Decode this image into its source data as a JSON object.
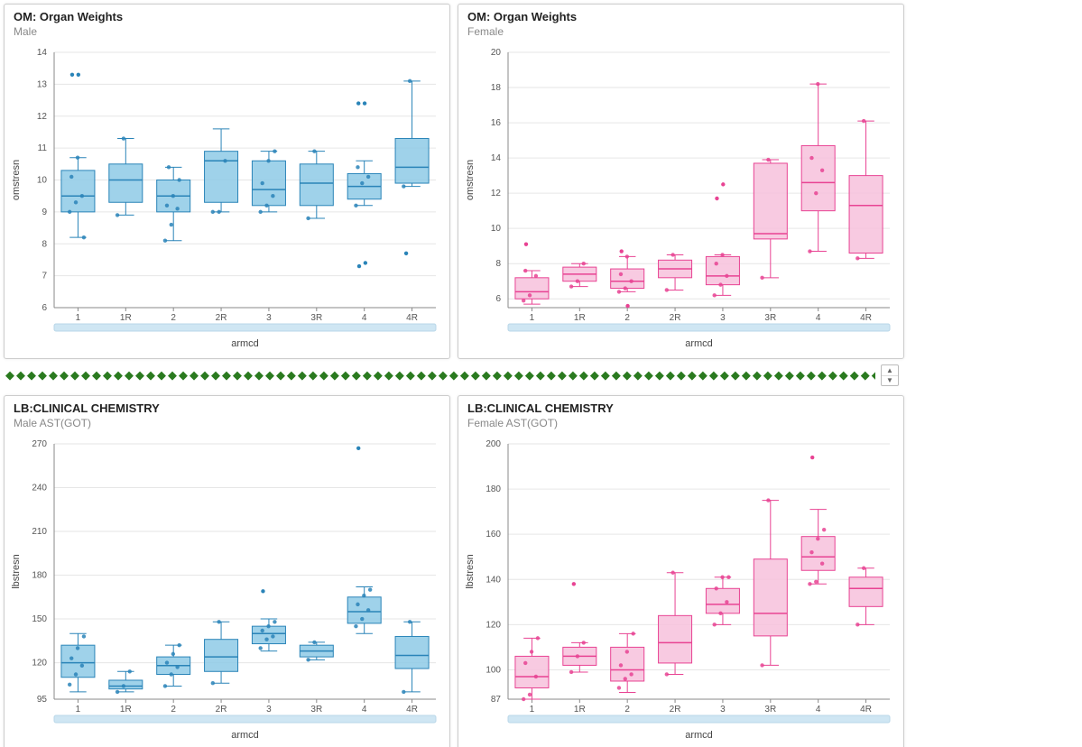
{
  "palette": {
    "male_fill": "#8ecae6",
    "male_stroke": "#2a84b8",
    "female_fill": "#f7c1dc",
    "female_stroke": "#e84393",
    "grid": "#e6e6e6",
    "text": "#444444"
  },
  "panels": {
    "om_male": {
      "title": "OM: Organ Weights",
      "subtitle": "Male",
      "xlabel": "armcd",
      "ylabel": "omstresn"
    },
    "om_female": {
      "title": "OM: Organ Weights",
      "subtitle": "Female",
      "xlabel": "armcd",
      "ylabel": "omstresn"
    },
    "lb_male": {
      "title": "LB:CLINICAL CHEMISTRY",
      "subtitle": "Male AST(GOT)",
      "xlabel": "armcd",
      "ylabel": "lbstresn"
    },
    "lb_female": {
      "title": "LB:CLINICAL CHEMISTRY",
      "subtitle": "Female AST(GOT)",
      "xlabel": "armcd",
      "ylabel": "lbstresn"
    }
  },
  "chart_data": [
    {
      "id": "om_male",
      "type": "box",
      "color": "male",
      "categories": [
        "1",
        "1R",
        "2",
        "2R",
        "3",
        "3R",
        "4",
        "4R"
      ],
      "ylim": [
        6,
        14
      ],
      "yticks": [
        6,
        7,
        8,
        9,
        10,
        11,
        12,
        13,
        14
      ],
      "series": [
        {
          "cat": "1",
          "min": 8.2,
          "q1": 9.0,
          "med": 9.5,
          "q3": 10.3,
          "max": 10.7,
          "pts": [
            9.0,
            9.3,
            9.5,
            10.1,
            10.7,
            8.2
          ],
          "outliers": [
            13.3,
            13.3
          ]
        },
        {
          "cat": "1R",
          "min": 8.9,
          "q1": 9.3,
          "med": 10.0,
          "q3": 10.5,
          "max": 11.3,
          "pts": [
            8.9,
            11.3
          ],
          "outliers": []
        },
        {
          "cat": "2",
          "min": 8.1,
          "q1": 9.0,
          "med": 9.5,
          "q3": 10.0,
          "max": 10.4,
          "pts": [
            8.1,
            8.6,
            9.1,
            9.2,
            9.5,
            10.0,
            10.4
          ],
          "outliers": []
        },
        {
          "cat": "2R",
          "min": 9.0,
          "q1": 9.3,
          "med": 10.6,
          "q3": 10.9,
          "max": 11.6,
          "pts": [
            9.0,
            9.0,
            10.6
          ],
          "outliers": []
        },
        {
          "cat": "3",
          "min": 9.0,
          "q1": 9.2,
          "med": 9.7,
          "q3": 10.6,
          "max": 10.9,
          "pts": [
            9.0,
            9.2,
            9.5,
            9.9,
            10.6,
            10.9
          ],
          "outliers": []
        },
        {
          "cat": "3R",
          "min": 8.8,
          "q1": 9.2,
          "med": 9.9,
          "q3": 10.5,
          "max": 10.9,
          "pts": [
            8.8,
            10.9
          ],
          "outliers": []
        },
        {
          "cat": "4",
          "min": 9.2,
          "q1": 9.4,
          "med": 9.8,
          "q3": 10.2,
          "max": 10.6,
          "pts": [
            9.2,
            9.9,
            10.1,
            10.4
          ],
          "outliers": [
            12.4,
            12.4,
            7.3,
            7.4
          ]
        },
        {
          "cat": "4R",
          "min": 9.8,
          "q1": 9.9,
          "med": 10.4,
          "q3": 11.3,
          "max": 13.1,
          "pts": [
            9.8,
            13.1
          ],
          "outliers": [
            7.7
          ]
        }
      ]
    },
    {
      "id": "om_female",
      "type": "box",
      "color": "female",
      "categories": [
        "1",
        "1R",
        "2",
        "2R",
        "3",
        "3R",
        "4",
        "4R"
      ],
      "ylim": [
        5.5,
        20
      ],
      "yticks": [
        6,
        8,
        10,
        12,
        14,
        16,
        18,
        20
      ],
      "series": [
        {
          "cat": "1",
          "min": 5.7,
          "q1": 6.0,
          "med": 6.4,
          "q3": 7.2,
          "max": 7.6,
          "pts": [
            5.9,
            6.2,
            7.3,
            7.6
          ],
          "outliers": [
            9.1
          ]
        },
        {
          "cat": "1R",
          "min": 6.7,
          "q1": 7.0,
          "med": 7.4,
          "q3": 7.8,
          "max": 8.0,
          "pts": [
            6.7,
            7.0,
            8.0
          ],
          "outliers": []
        },
        {
          "cat": "2",
          "min": 6.4,
          "q1": 6.6,
          "med": 7.0,
          "q3": 7.7,
          "max": 8.4,
          "pts": [
            6.4,
            6.6,
            7.0,
            7.4,
            8.4
          ],
          "outliers": [
            8.7,
            5.6
          ]
        },
        {
          "cat": "2R",
          "min": 6.5,
          "q1": 7.2,
          "med": 7.7,
          "q3": 8.2,
          "max": 8.5,
          "pts": [
            6.5,
            8.5
          ],
          "outliers": []
        },
        {
          "cat": "3",
          "min": 6.2,
          "q1": 6.8,
          "med": 7.3,
          "q3": 8.4,
          "max": 8.5,
          "pts": [
            6.2,
            6.8,
            7.3,
            8.0,
            8.5
          ],
          "outliers": [
            11.7,
            12.5
          ]
        },
        {
          "cat": "3R",
          "min": 7.2,
          "q1": 9.4,
          "med": 9.7,
          "q3": 13.7,
          "max": 13.9,
          "pts": [
            7.2,
            13.9
          ],
          "outliers": []
        },
        {
          "cat": "4",
          "min": 8.7,
          "q1": 11.0,
          "med": 12.6,
          "q3": 14.7,
          "max": 18.2,
          "pts": [
            8.7,
            12.0,
            13.3,
            14.0,
            18.2
          ],
          "outliers": []
        },
        {
          "cat": "4R",
          "min": 8.3,
          "q1": 8.6,
          "med": 11.3,
          "q3": 13.0,
          "max": 16.1,
          "pts": [
            8.3,
            16.1
          ],
          "outliers": []
        }
      ]
    },
    {
      "id": "lb_male",
      "type": "box",
      "color": "male",
      "categories": [
        "1",
        "1R",
        "2",
        "2R",
        "3",
        "3R",
        "4",
        "4R"
      ],
      "ylim": [
        95,
        270
      ],
      "yticks": [
        95,
        120,
        150,
        180,
        210,
        240,
        270
      ],
      "series": [
        {
          "cat": "1",
          "min": 100,
          "q1": 110,
          "med": 120,
          "q3": 132,
          "max": 140,
          "pts": [
            105,
            112,
            118,
            123,
            130,
            138
          ],
          "outliers": []
        },
        {
          "cat": "1R",
          "min": 100,
          "q1": 102,
          "med": 104,
          "q3": 108,
          "max": 114,
          "pts": [
            100,
            104,
            114
          ],
          "outliers": []
        },
        {
          "cat": "2",
          "min": 104,
          "q1": 112,
          "med": 118,
          "q3": 124,
          "max": 132,
          "pts": [
            104,
            112,
            117,
            120,
            126,
            132
          ],
          "outliers": []
        },
        {
          "cat": "2R",
          "min": 106,
          "q1": 114,
          "med": 124,
          "q3": 136,
          "max": 148,
          "pts": [
            106,
            148
          ],
          "outliers": []
        },
        {
          "cat": "3",
          "min": 128,
          "q1": 133,
          "med": 140,
          "q3": 145,
          "max": 150,
          "pts": [
            130,
            136,
            138,
            142,
            145,
            148
          ],
          "outliers": [
            169
          ]
        },
        {
          "cat": "3R",
          "min": 122,
          "q1": 124,
          "med": 128,
          "q3": 132,
          "max": 134,
          "pts": [
            122,
            134
          ],
          "outliers": []
        },
        {
          "cat": "4",
          "min": 140,
          "q1": 147,
          "med": 155,
          "q3": 165,
          "max": 172,
          "pts": [
            145,
            150,
            156,
            160,
            166,
            170
          ],
          "outliers": [
            267
          ]
        },
        {
          "cat": "4R",
          "min": 100,
          "q1": 116,
          "med": 125,
          "q3": 138,
          "max": 148,
          "pts": [
            100,
            148
          ],
          "outliers": []
        }
      ]
    },
    {
      "id": "lb_female",
      "type": "box",
      "color": "female",
      "categories": [
        "1",
        "1R",
        "2",
        "2R",
        "3",
        "3R",
        "4",
        "4R"
      ],
      "ylim": [
        87,
        200
      ],
      "yticks": [
        87,
        100,
        120,
        140,
        160,
        180,
        200
      ],
      "series": [
        {
          "cat": "1",
          "min": 87,
          "q1": 92,
          "med": 97,
          "q3": 106,
          "max": 114,
          "pts": [
            87,
            89,
            97,
            103,
            108,
            114
          ],
          "outliers": []
        },
        {
          "cat": "1R",
          "min": 99,
          "q1": 102,
          "med": 106,
          "q3": 110,
          "max": 112,
          "pts": [
            99,
            106,
            112
          ],
          "outliers": [
            138
          ]
        },
        {
          "cat": "2",
          "min": 90,
          "q1": 95,
          "med": 100,
          "q3": 110,
          "max": 116,
          "pts": [
            92,
            96,
            98,
            102,
            108,
            116
          ],
          "outliers": []
        },
        {
          "cat": "2R",
          "min": 98,
          "q1": 103,
          "med": 112,
          "q3": 124,
          "max": 143,
          "pts": [
            98,
            143
          ],
          "outliers": []
        },
        {
          "cat": "3",
          "min": 120,
          "q1": 125,
          "med": 129,
          "q3": 136,
          "max": 141,
          "pts": [
            120,
            125,
            130,
            136,
            141,
            141
          ],
          "outliers": []
        },
        {
          "cat": "3R",
          "min": 102,
          "q1": 115,
          "med": 125,
          "q3": 149,
          "max": 175,
          "pts": [
            102,
            175
          ],
          "outliers": []
        },
        {
          "cat": "4",
          "min": 138,
          "q1": 144,
          "med": 150,
          "q3": 159,
          "max": 171,
          "pts": [
            138,
            139,
            147,
            152,
            158,
            162
          ],
          "outliers": [
            194
          ]
        },
        {
          "cat": "4R",
          "min": 120,
          "q1": 128,
          "med": 136,
          "q3": 141,
          "max": 145,
          "pts": [
            120,
            145
          ],
          "outliers": []
        }
      ]
    }
  ]
}
